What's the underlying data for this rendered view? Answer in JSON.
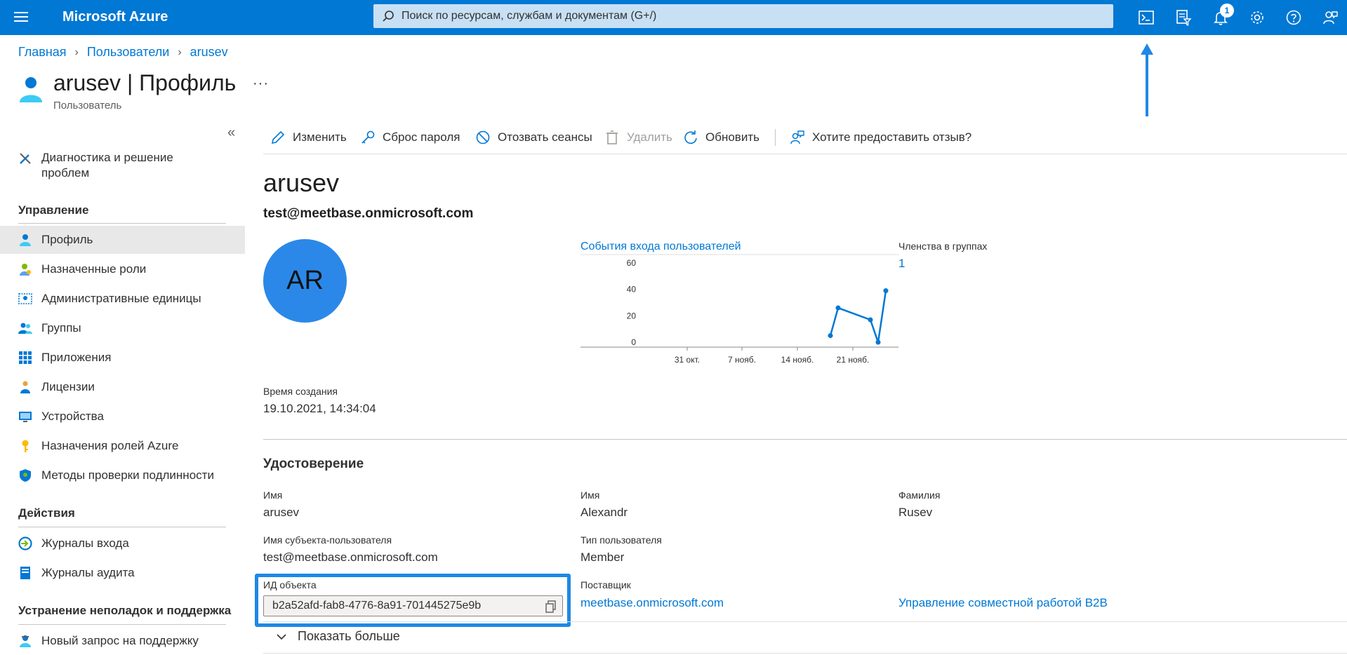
{
  "topbar": {
    "brand": "Microsoft Azure",
    "search_placeholder": "Поиск по ресурсам, службам и документам (G+/)",
    "notification_count": "1",
    "icons": [
      "cloud-shell-icon",
      "directory-filter-icon",
      "bell-icon",
      "gear-icon",
      "help-icon",
      "feedback-icon"
    ],
    "accent": "#0078d4"
  },
  "breadcrumb": [
    "Главная",
    "Пользователи",
    "arusev"
  ],
  "header": {
    "title": "arusev | Профиль",
    "subtitle": "Пользователь",
    "more": "···"
  },
  "sidebar": {
    "collapse": "«",
    "top_item": "Диагностика и решение проблем",
    "top_item_line1": "Диагностика и решение",
    "top_item_line2": "проблем",
    "sections": [
      {
        "title": "Управление",
        "items": [
          {
            "label": "Профиль",
            "icon": "user-icon",
            "active": true
          },
          {
            "label": "Назначенные роли",
            "icon": "roles-icon"
          },
          {
            "label": "Административные единицы",
            "icon": "admin-units-icon"
          },
          {
            "label": "Группы",
            "icon": "groups-icon"
          },
          {
            "label": "Приложения",
            "icon": "apps-grid-icon"
          },
          {
            "label": "Лицензии",
            "icon": "license-icon"
          },
          {
            "label": "Устройства",
            "icon": "device-icon"
          },
          {
            "label": "Назначения ролей Azure",
            "icon": "key-icon"
          },
          {
            "label": "Методы проверки подлинности",
            "icon": "shield-icon"
          }
        ]
      },
      {
        "title": "Действия",
        "items": [
          {
            "label": "Журналы входа",
            "icon": "sign-in-logs-icon"
          },
          {
            "label": "Журналы аудита",
            "icon": "audit-logs-icon"
          }
        ]
      },
      {
        "title": "Устранение неполадок и поддержка",
        "items": [
          {
            "label": "Новый запрос на поддержку",
            "icon": "support-icon"
          }
        ]
      }
    ]
  },
  "commands": {
    "edit": "Изменить",
    "reset_password": "Сброс пароля",
    "revoke_sessions": "Отозвать сеансы",
    "delete": "Удалить",
    "refresh": "Обновить",
    "feedback": "Хотите предоставить отзыв?"
  },
  "profile": {
    "name": "arusev",
    "upn": "test@meetbase.onmicrosoft.com",
    "initials": "AR",
    "created_label": "Время создания",
    "created_value": "19.10.2021, 14:34:04"
  },
  "groups": {
    "label": "Членства в группах",
    "value": "1"
  },
  "chart_data": {
    "type": "line",
    "title": "События входа пользователей",
    "y_ticks": [
      "60",
      "40",
      "20",
      "0"
    ],
    "x_tick_labels": [
      "31 окт.",
      "7 нояб.",
      "14 нояб.",
      "21 нояб."
    ],
    "ylim": [
      0,
      60
    ],
    "series": [
      {
        "points": [
          [
            1,
            5
          ],
          [
            2,
            26
          ],
          [
            3,
            17
          ],
          [
            4,
            0
          ],
          [
            5,
            39
          ]
        ]
      }
    ],
    "color": "#0078d4"
  },
  "identity": {
    "section_title": "Удостоверение",
    "fields": {
      "display_name_label": "Имя",
      "display_name_value": "arusev",
      "given_name_label": "Имя",
      "given_name_value": "Alexandr",
      "surname_label": "Фамилия",
      "surname_value": "Rusev",
      "upn_label": "Имя субъекта-пользователя",
      "upn_value": "test@meetbase.onmicrosoft.com",
      "user_type_label": "Тип пользователя",
      "user_type_value": "Member",
      "object_id_label": "ИД объекта",
      "object_id_value": "b2a52afd-fab8-4776-8a91-701445275e9b",
      "issuer_label": "Поставщик",
      "issuer_value": "meetbase.onmicrosoft.com",
      "b2b_link": "Управление совместной работой B2B"
    },
    "show_more": "Показать больше"
  }
}
